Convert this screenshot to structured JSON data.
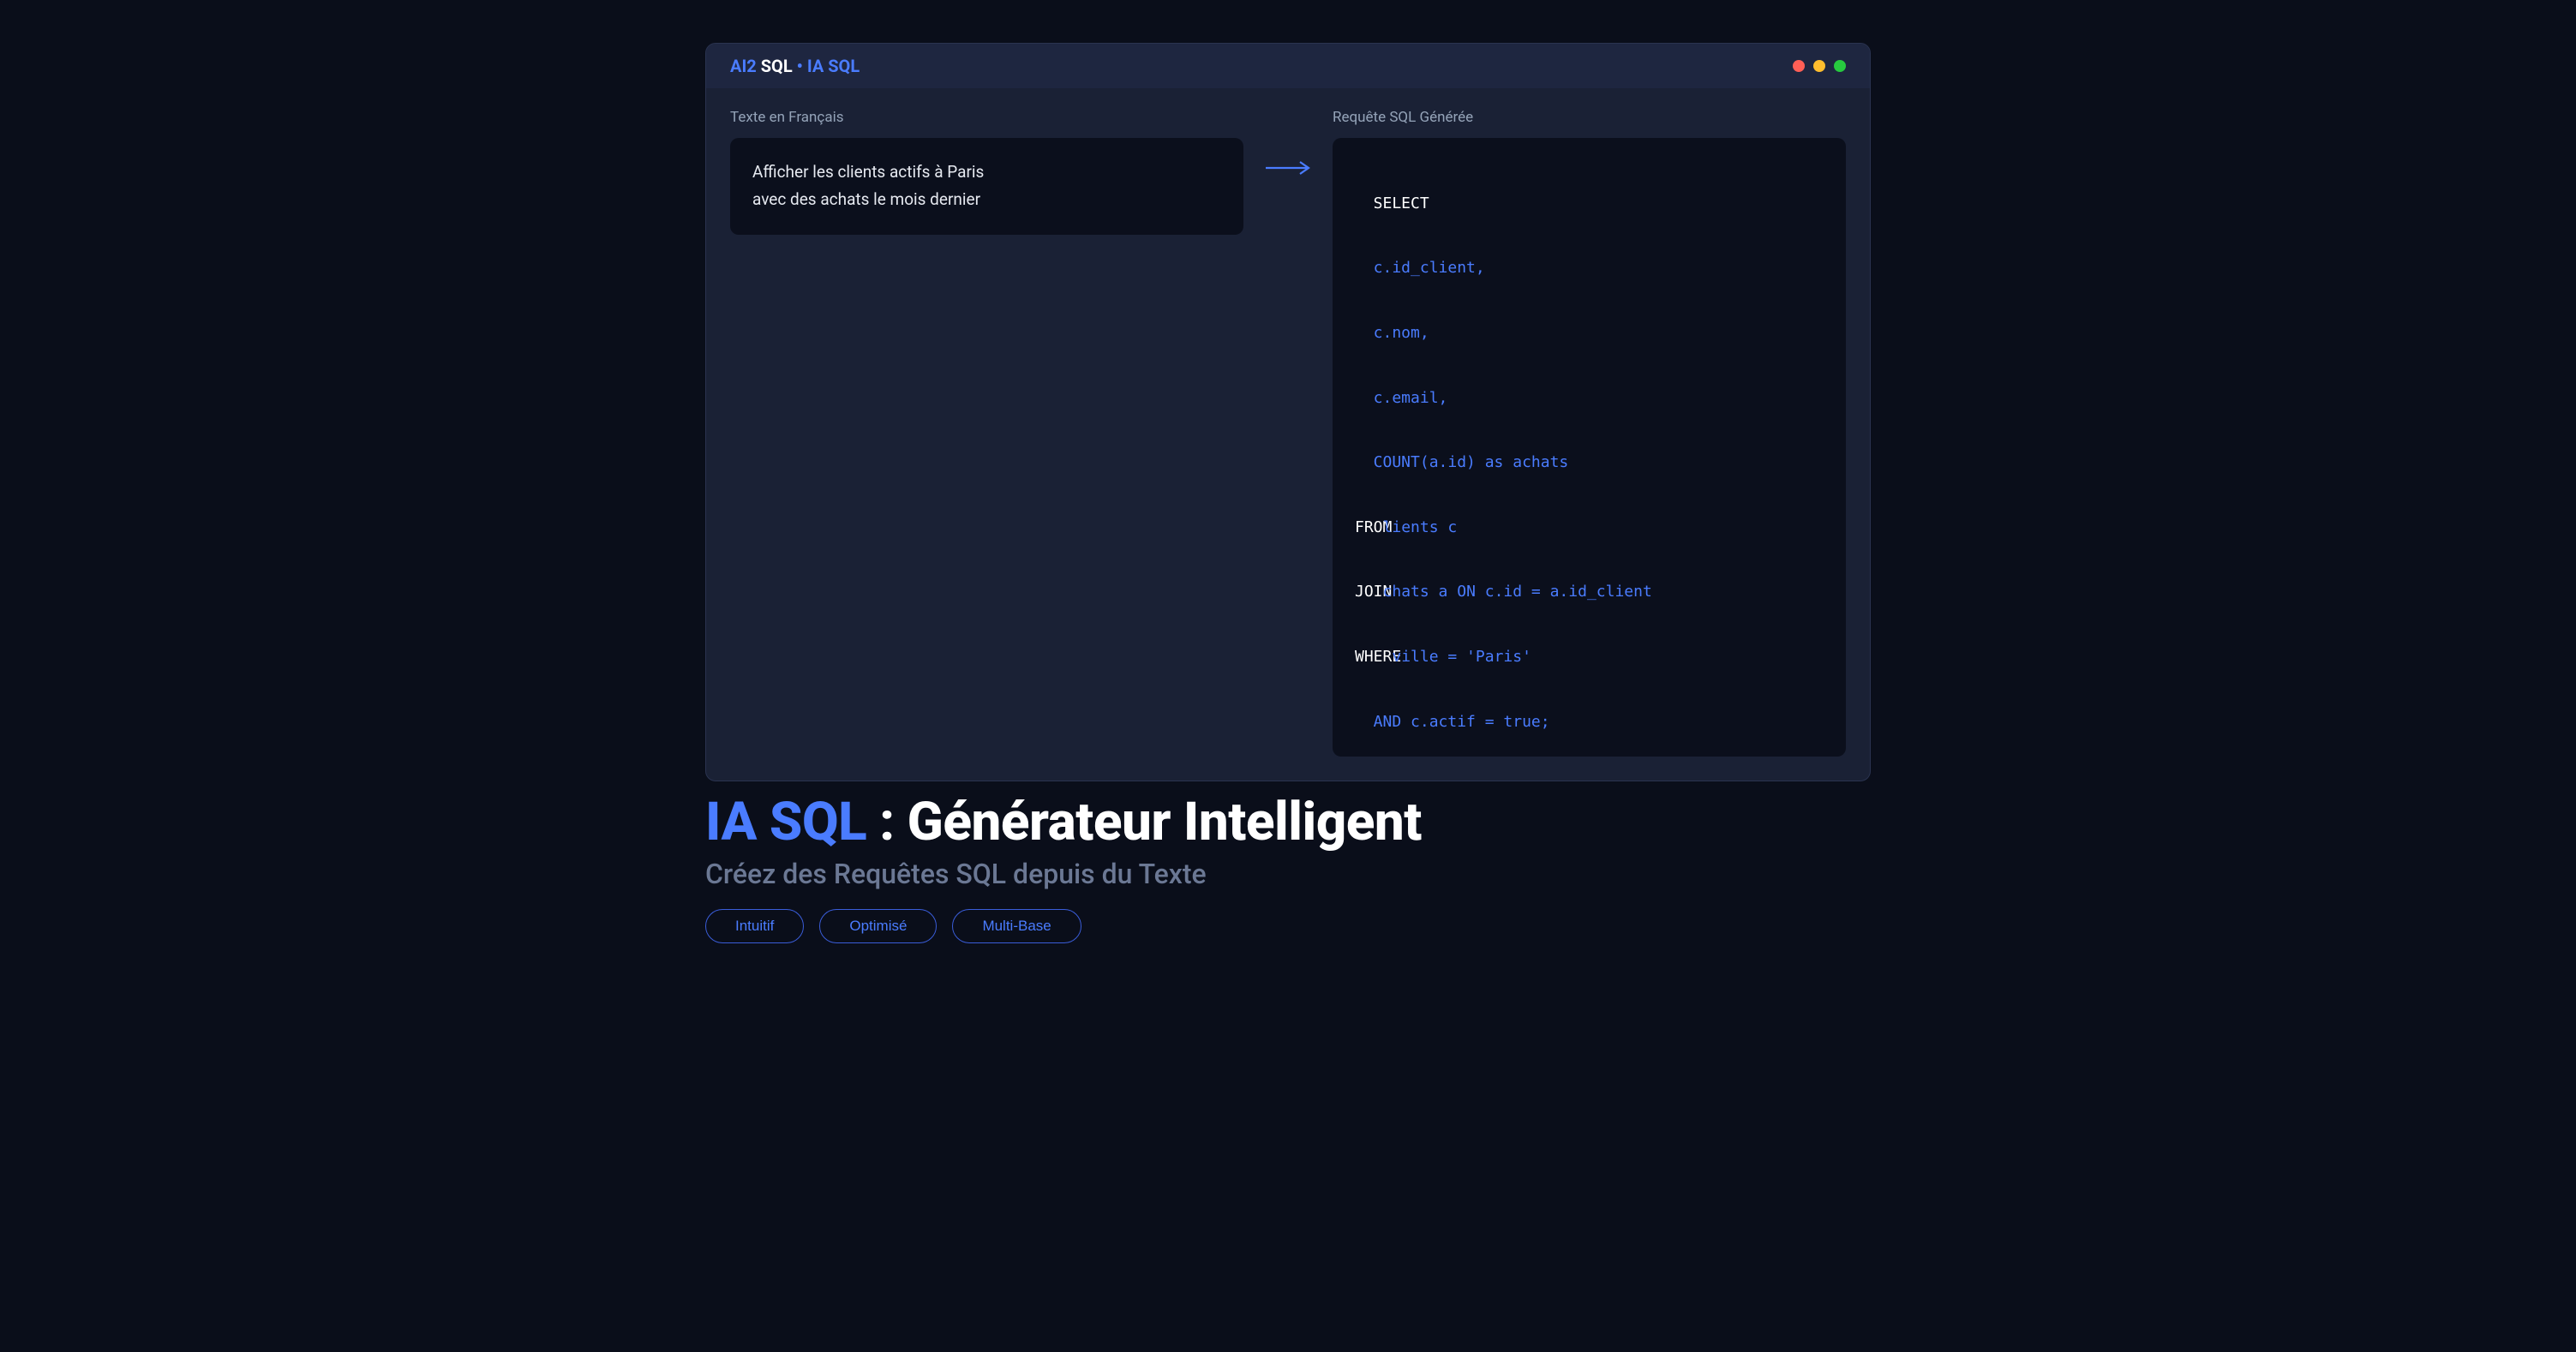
{
  "titlebar": {
    "brand_prefix": "AI2",
    "brand_main": " SQL",
    "separator": " • ",
    "brand_suffix": "IA SQL"
  },
  "left_pane": {
    "label": "Texte en Français",
    "text_line1": "Afficher les clients actifs à Paris",
    "text_line2": "avec des achats le mois dernier"
  },
  "right_pane": {
    "label": "Requête SQL Générée",
    "code": {
      "l1_kw": "SELECT",
      "l2": "c.id_client,",
      "l3": "c.nom,",
      "l4": "c.email,",
      "l5": "COUNT(a.id) as achats",
      "l6_kw": "FROM",
      "l6_rest": "lients c",
      "l7_kw": "JOIN",
      "l7_rest": "chats a ON c.id = a.id_client",
      "l8_kw": "WHERE",
      "l8_rest": "ville = 'Paris'",
      "l9": "AND c.actif = true;"
    }
  },
  "hero": {
    "title_blue": "IA SQL",
    "title_white": " : Générateur Intelligent",
    "subtitle": "Créez des Requêtes SQL depuis du Texte"
  },
  "pills": {
    "p1": "Intuitif",
    "p2": "Optimisé",
    "p3": "Multi-Base"
  }
}
